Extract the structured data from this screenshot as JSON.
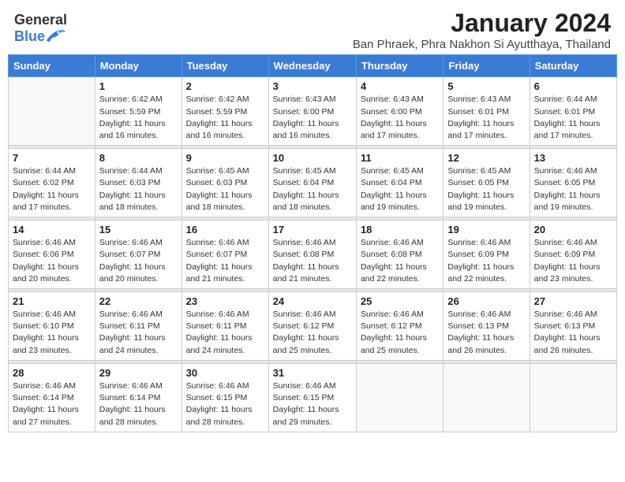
{
  "header": {
    "logo_general": "General",
    "logo_blue": "Blue",
    "title": "January 2024",
    "subtitle": "Ban Phraek, Phra Nakhon Si Ayutthaya, Thailand"
  },
  "weekdays": [
    "Sunday",
    "Monday",
    "Tuesday",
    "Wednesday",
    "Thursday",
    "Friday",
    "Saturday"
  ],
  "weeks": [
    [
      {
        "day": "",
        "sunrise": "",
        "sunset": "",
        "daylight": ""
      },
      {
        "day": "1",
        "sunrise": "Sunrise: 6:42 AM",
        "sunset": "Sunset: 5:59 PM",
        "daylight": "Daylight: 11 hours and 16 minutes."
      },
      {
        "day": "2",
        "sunrise": "Sunrise: 6:42 AM",
        "sunset": "Sunset: 5:59 PM",
        "daylight": "Daylight: 11 hours and 16 minutes."
      },
      {
        "day": "3",
        "sunrise": "Sunrise: 6:43 AM",
        "sunset": "Sunset: 6:00 PM",
        "daylight": "Daylight: 11 hours and 16 minutes."
      },
      {
        "day": "4",
        "sunrise": "Sunrise: 6:43 AM",
        "sunset": "Sunset: 6:00 PM",
        "daylight": "Daylight: 11 hours and 17 minutes."
      },
      {
        "day": "5",
        "sunrise": "Sunrise: 6:43 AM",
        "sunset": "Sunset: 6:01 PM",
        "daylight": "Daylight: 11 hours and 17 minutes."
      },
      {
        "day": "6",
        "sunrise": "Sunrise: 6:44 AM",
        "sunset": "Sunset: 6:01 PM",
        "daylight": "Daylight: 11 hours and 17 minutes."
      }
    ],
    [
      {
        "day": "7",
        "sunrise": "Sunrise: 6:44 AM",
        "sunset": "Sunset: 6:02 PM",
        "daylight": "Daylight: 11 hours and 17 minutes."
      },
      {
        "day": "8",
        "sunrise": "Sunrise: 6:44 AM",
        "sunset": "Sunset: 6:03 PM",
        "daylight": "Daylight: 11 hours and 18 minutes."
      },
      {
        "day": "9",
        "sunrise": "Sunrise: 6:45 AM",
        "sunset": "Sunset: 6:03 PM",
        "daylight": "Daylight: 11 hours and 18 minutes."
      },
      {
        "day": "10",
        "sunrise": "Sunrise: 6:45 AM",
        "sunset": "Sunset: 6:04 PM",
        "daylight": "Daylight: 11 hours and 18 minutes."
      },
      {
        "day": "11",
        "sunrise": "Sunrise: 6:45 AM",
        "sunset": "Sunset: 6:04 PM",
        "daylight": "Daylight: 11 hours and 19 minutes."
      },
      {
        "day": "12",
        "sunrise": "Sunrise: 6:45 AM",
        "sunset": "Sunset: 6:05 PM",
        "daylight": "Daylight: 11 hours and 19 minutes."
      },
      {
        "day": "13",
        "sunrise": "Sunrise: 6:46 AM",
        "sunset": "Sunset: 6:05 PM",
        "daylight": "Daylight: 11 hours and 19 minutes."
      }
    ],
    [
      {
        "day": "14",
        "sunrise": "Sunrise: 6:46 AM",
        "sunset": "Sunset: 6:06 PM",
        "daylight": "Daylight: 11 hours and 20 minutes."
      },
      {
        "day": "15",
        "sunrise": "Sunrise: 6:46 AM",
        "sunset": "Sunset: 6:07 PM",
        "daylight": "Daylight: 11 hours and 20 minutes."
      },
      {
        "day": "16",
        "sunrise": "Sunrise: 6:46 AM",
        "sunset": "Sunset: 6:07 PM",
        "daylight": "Daylight: 11 hours and 21 minutes."
      },
      {
        "day": "17",
        "sunrise": "Sunrise: 6:46 AM",
        "sunset": "Sunset: 6:08 PM",
        "daylight": "Daylight: 11 hours and 21 minutes."
      },
      {
        "day": "18",
        "sunrise": "Sunrise: 6:46 AM",
        "sunset": "Sunset: 6:08 PM",
        "daylight": "Daylight: 11 hours and 22 minutes."
      },
      {
        "day": "19",
        "sunrise": "Sunrise: 6:46 AM",
        "sunset": "Sunset: 6:09 PM",
        "daylight": "Daylight: 11 hours and 22 minutes."
      },
      {
        "day": "20",
        "sunrise": "Sunrise: 6:46 AM",
        "sunset": "Sunset: 6:09 PM",
        "daylight": "Daylight: 11 hours and 23 minutes."
      }
    ],
    [
      {
        "day": "21",
        "sunrise": "Sunrise: 6:46 AM",
        "sunset": "Sunset: 6:10 PM",
        "daylight": "Daylight: 11 hours and 23 minutes."
      },
      {
        "day": "22",
        "sunrise": "Sunrise: 6:46 AM",
        "sunset": "Sunset: 6:11 PM",
        "daylight": "Daylight: 11 hours and 24 minutes."
      },
      {
        "day": "23",
        "sunrise": "Sunrise: 6:46 AM",
        "sunset": "Sunset: 6:11 PM",
        "daylight": "Daylight: 11 hours and 24 minutes."
      },
      {
        "day": "24",
        "sunrise": "Sunrise: 6:46 AM",
        "sunset": "Sunset: 6:12 PM",
        "daylight": "Daylight: 11 hours and 25 minutes."
      },
      {
        "day": "25",
        "sunrise": "Sunrise: 6:46 AM",
        "sunset": "Sunset: 6:12 PM",
        "daylight": "Daylight: 11 hours and 25 minutes."
      },
      {
        "day": "26",
        "sunrise": "Sunrise: 6:46 AM",
        "sunset": "Sunset: 6:13 PM",
        "daylight": "Daylight: 11 hours and 26 minutes."
      },
      {
        "day": "27",
        "sunrise": "Sunrise: 6:46 AM",
        "sunset": "Sunset: 6:13 PM",
        "daylight": "Daylight: 11 hours and 26 minutes."
      }
    ],
    [
      {
        "day": "28",
        "sunrise": "Sunrise: 6:46 AM",
        "sunset": "Sunset: 6:14 PM",
        "daylight": "Daylight: 11 hours and 27 minutes."
      },
      {
        "day": "29",
        "sunrise": "Sunrise: 6:46 AM",
        "sunset": "Sunset: 6:14 PM",
        "daylight": "Daylight: 11 hours and 28 minutes."
      },
      {
        "day": "30",
        "sunrise": "Sunrise: 6:46 AM",
        "sunset": "Sunset: 6:15 PM",
        "daylight": "Daylight: 11 hours and 28 minutes."
      },
      {
        "day": "31",
        "sunrise": "Sunrise: 6:46 AM",
        "sunset": "Sunset: 6:15 PM",
        "daylight": "Daylight: 11 hours and 29 minutes."
      },
      {
        "day": "",
        "sunrise": "",
        "sunset": "",
        "daylight": ""
      },
      {
        "day": "",
        "sunrise": "",
        "sunset": "",
        "daylight": ""
      },
      {
        "day": "",
        "sunrise": "",
        "sunset": "",
        "daylight": ""
      }
    ]
  ]
}
